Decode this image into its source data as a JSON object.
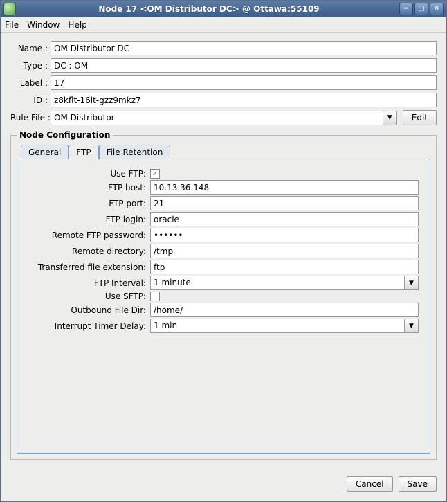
{
  "window": {
    "title": "Node 17 <OM Distributor DC> @ Ottawa:55109"
  },
  "menu": {
    "file": "File",
    "window": "Window",
    "help": "Help"
  },
  "form": {
    "name_label": "Name :",
    "name_value": "OM Distributor DC",
    "type_label": "Type :",
    "type_value": "DC : OM",
    "label_label": "Label :",
    "label_value": "17",
    "id_label": "ID :",
    "id_value": "z8kflt-16it-gzz9mkz7",
    "rulefile_label": "Rule File :",
    "rulefile_value": "OM Distributor",
    "edit_btn": "Edit"
  },
  "fieldset": {
    "legend": "Node Configuration"
  },
  "tabs": {
    "general": "General",
    "ftp": "FTP",
    "fileret": "File Retention"
  },
  "ftp": {
    "use_ftp_label": "Use FTP:",
    "use_ftp_checked": true,
    "host_label": "FTP host:",
    "host_value": "10.13.36.148",
    "port_label": "FTP port:",
    "port_value": "21",
    "login_label": "FTP login:",
    "login_value": "oracle",
    "password_label": "Remote FTP password:",
    "password_value": "••••••",
    "remotedir_label": "Remote directory:",
    "remotedir_value": "/tmp",
    "ext_label": "Transferred file extension:",
    "ext_value": "ftp",
    "interval_label": "FTP Interval:",
    "interval_value": "1 minute",
    "use_sftp_label": "Use SFTP:",
    "use_sftp_checked": false,
    "outdir_label": "Outbound File Dir:",
    "outdir_value": "/home/",
    "delay_label": "Interrupt Timer Delay:",
    "delay_value": "1 min"
  },
  "footer": {
    "cancel": "Cancel",
    "save": "Save"
  }
}
